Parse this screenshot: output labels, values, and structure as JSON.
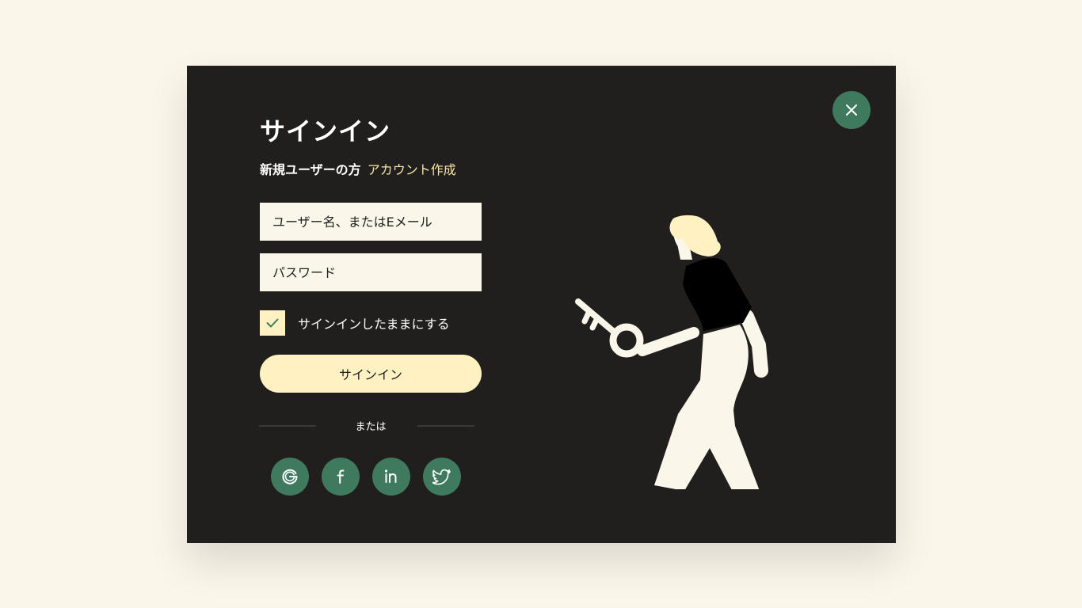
{
  "modal": {
    "title": "サインイン",
    "new_user_text": "新規ユーザーの方",
    "create_account_link": "アカウント作成",
    "username_placeholder": "ユーザー名、またはEメール",
    "password_placeholder": "パスワード",
    "remember_me_label": "サインインしたままにする",
    "remember_me_checked": true,
    "signin_button": "サインイン",
    "divider_text": "または",
    "social_buttons": [
      "google-icon",
      "facebook-icon",
      "linkedin-icon",
      "twitter-icon"
    ],
    "close_icon": "close-icon"
  },
  "colors": {
    "page_bg": "#fbf6ea",
    "modal_bg": "#201f1d",
    "accent_green": "#3f7a5e",
    "accent_cream": "#fff1c2",
    "link_color": "#fbe6a8"
  }
}
